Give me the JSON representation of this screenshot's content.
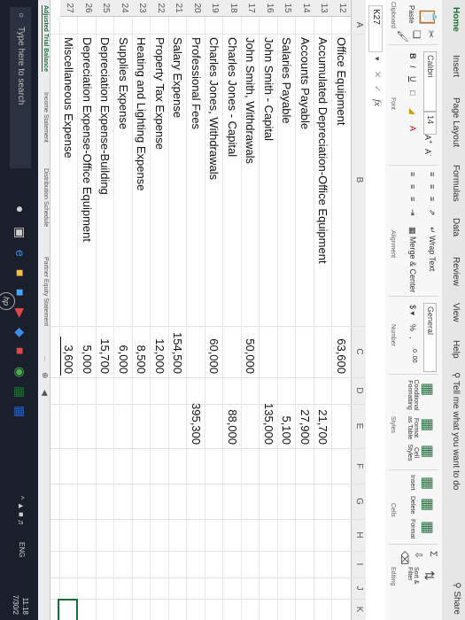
{
  "ribbon": {
    "tabs": [
      "Home",
      "Insert",
      "Page Layout",
      "Formulas",
      "Data",
      "Review",
      "View",
      "Help"
    ],
    "tell_me": "Tell me what you want to do",
    "share": "Share",
    "font_name": "Calibri",
    "font_size": "14",
    "number_format": "General",
    "wrap_text": "Wrap Text",
    "merge_center": "Merge & Center",
    "conditional_formatting": "Conditional Formatting",
    "format_as_table": "Format as Table",
    "cell_styles": "Cell Styles",
    "insert": "Insert",
    "delete": "Delete",
    "format": "Format",
    "sort_filter": "Sort & Filter",
    "groups": [
      "Clipboard",
      "Font",
      "Alignment",
      "Number",
      "Styles",
      "Cells",
      "Editing"
    ],
    "paste": "Paste"
  },
  "formula_bar": {
    "name_box": "K27",
    "fx": "fx",
    "content": ""
  },
  "columns": [
    "A",
    "B",
    "C",
    "D",
    "E",
    "F",
    "G",
    "H",
    "I",
    "J",
    "K"
  ],
  "rows": [
    {
      "num": "12",
      "label": "Office Equipment",
      "debit": "63,600",
      "credit": ""
    },
    {
      "num": "13",
      "label": "Accumulated Depreciation-Office Equipment",
      "debit": "",
      "credit": "21,700"
    },
    {
      "num": "14",
      "label": "Accounts Payable",
      "debit": "",
      "credit": "27,900"
    },
    {
      "num": "15",
      "label": "Salaries Payable",
      "debit": "",
      "credit": "5,100"
    },
    {
      "num": "16",
      "label": "John Smith - Capital",
      "debit": "",
      "credit": "135,000"
    },
    {
      "num": "17",
      "label": "John Smith, Withdrawals",
      "debit": "50,000",
      "credit": ""
    },
    {
      "num": "18",
      "label": "Charles Jones - Capital",
      "debit": "",
      "credit": "88,000"
    },
    {
      "num": "19",
      "label": "Charles Jones, Withdrawals",
      "debit": "60,000",
      "credit": ""
    },
    {
      "num": "20",
      "label": "Professional Fees",
      "debit": "",
      "credit": "395,300"
    },
    {
      "num": "21",
      "label": "Salary Expense",
      "debit": "154,500",
      "credit": ""
    },
    {
      "num": "22",
      "label": "Property Tax Expense",
      "debit": "12,000",
      "credit": ""
    },
    {
      "num": "23",
      "label": "Heating and Lighting Expense",
      "debit": "8,500",
      "credit": ""
    },
    {
      "num": "24",
      "label": "Supplies Expense",
      "debit": "6,000",
      "credit": ""
    },
    {
      "num": "25",
      "label": "Depreciation Expense-Building",
      "debit": "15,700",
      "credit": ""
    },
    {
      "num": "26",
      "label": "Depreciation Expense-Office Equipment",
      "debit": "5,000",
      "credit": ""
    },
    {
      "num": "27",
      "label": "Miscellaneous Expense",
      "debit": "3,600",
      "credit": ""
    }
  ],
  "sheet_tabs": [
    "Adjusted Trial Balance",
    "Income Statement",
    "Distribution Schedule",
    "Partner Equity Statement",
    "..."
  ],
  "taskbar": {
    "search_placeholder": "Type here to search",
    "lang": "ENG",
    "time": "11:18",
    "date": "7/30/2"
  },
  "brand": "hp",
  "colors": {
    "excel_green": "#1e6d39",
    "taskbar": "#1a1f2b"
  }
}
